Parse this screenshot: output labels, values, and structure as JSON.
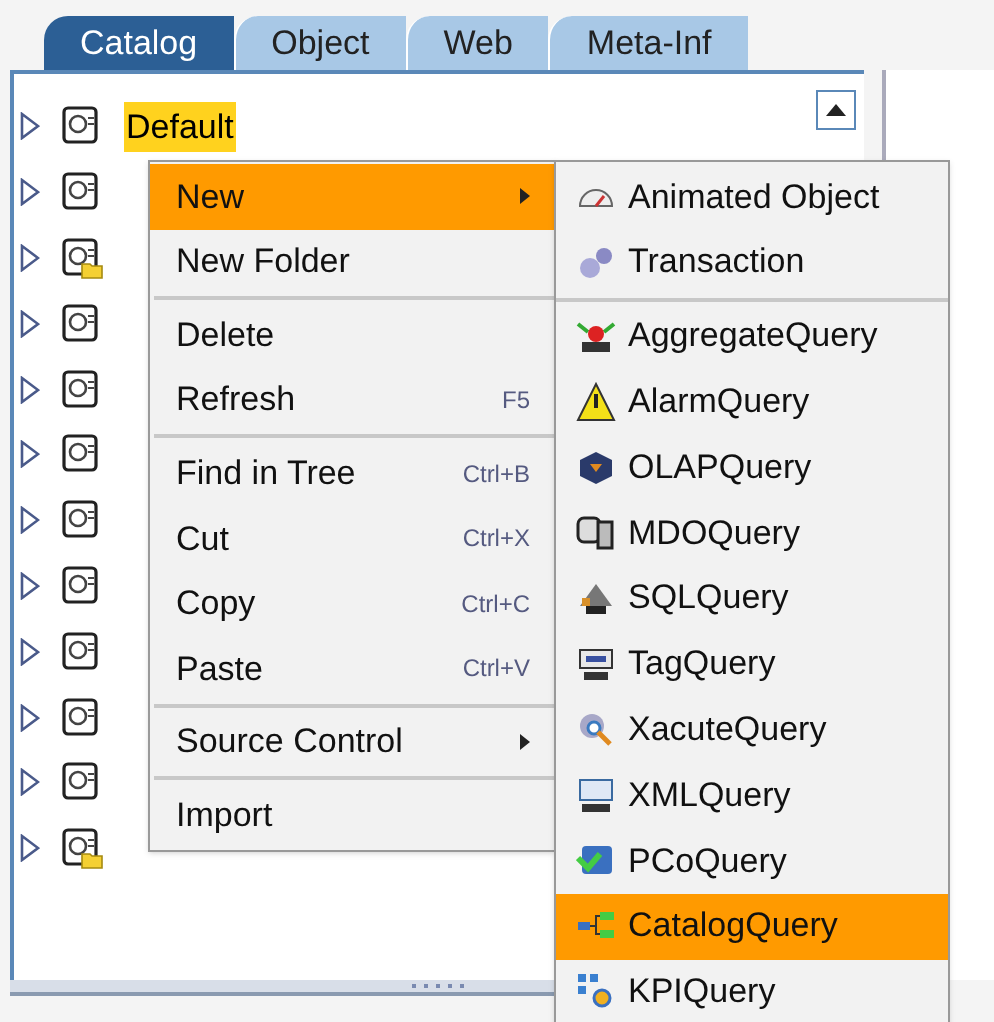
{
  "tabs": [
    {
      "label": "Catalog",
      "selected": true
    },
    {
      "label": "Object",
      "selected": false
    },
    {
      "label": "Web",
      "selected": false
    },
    {
      "label": "Meta-Inf",
      "selected": false
    }
  ],
  "tree": {
    "items": [
      {
        "kind": "project",
        "label": "Default",
        "selected": true
      },
      {
        "kind": "project",
        "selected": false
      },
      {
        "kind": "folder",
        "selected": false
      },
      {
        "kind": "project",
        "selected": false
      },
      {
        "kind": "project",
        "selected": false
      },
      {
        "kind": "project",
        "selected": false
      },
      {
        "kind": "project",
        "selected": false
      },
      {
        "kind": "project",
        "selected": false
      },
      {
        "kind": "project",
        "selected": false
      },
      {
        "kind": "project",
        "selected": false
      },
      {
        "kind": "project",
        "selected": false
      },
      {
        "kind": "folder",
        "selected": false
      }
    ]
  },
  "context_menu": {
    "items": [
      {
        "kind": "item",
        "label": "New",
        "submenu": true,
        "selected": true
      },
      {
        "kind": "item",
        "label": "New Folder",
        "submenu": false,
        "selected": false
      },
      {
        "kind": "separator"
      },
      {
        "kind": "item",
        "label": "Delete",
        "submenu": false,
        "selected": false
      },
      {
        "kind": "item",
        "label": "Refresh",
        "shortcut": "F5",
        "submenu": false,
        "selected": false
      },
      {
        "kind": "separator"
      },
      {
        "kind": "item",
        "label": "Find in Tree",
        "shortcut": "Ctrl+B",
        "submenu": false,
        "selected": false
      },
      {
        "kind": "item",
        "label": "Cut",
        "shortcut": "Ctrl+X",
        "submenu": false,
        "selected": false
      },
      {
        "kind": "item",
        "label": "Copy",
        "shortcut": "Ctrl+C",
        "submenu": false,
        "selected": false
      },
      {
        "kind": "item",
        "label": "Paste",
        "shortcut": "Ctrl+V",
        "submenu": false,
        "selected": false
      },
      {
        "kind": "separator"
      },
      {
        "kind": "item",
        "label": "Source Control",
        "submenu": true,
        "selected": false
      },
      {
        "kind": "separator"
      },
      {
        "kind": "item",
        "label": "Import",
        "submenu": false,
        "selected": false
      }
    ]
  },
  "submenu": {
    "items": [
      {
        "kind": "item",
        "label": "Animated Object",
        "selected": false
      },
      {
        "kind": "item",
        "label": "Transaction",
        "selected": false
      },
      {
        "kind": "separator"
      },
      {
        "kind": "item",
        "label": "AggregateQuery",
        "selected": false
      },
      {
        "kind": "item",
        "label": "AlarmQuery",
        "selected": false
      },
      {
        "kind": "item",
        "label": "OLAPQuery",
        "selected": false
      },
      {
        "kind": "item",
        "label": "MDOQuery",
        "selected": false
      },
      {
        "kind": "item",
        "label": "SQLQuery",
        "selected": false
      },
      {
        "kind": "item",
        "label": "TagQuery",
        "selected": false
      },
      {
        "kind": "item",
        "label": "XacuteQuery",
        "selected": false
      },
      {
        "kind": "item",
        "label": "XMLQuery",
        "selected": false
      },
      {
        "kind": "item",
        "label": "PCoQuery",
        "selected": false
      },
      {
        "kind": "item",
        "label": "CatalogQuery",
        "selected": true
      },
      {
        "kind": "item",
        "label": "KPIQuery",
        "selected": false
      }
    ]
  }
}
